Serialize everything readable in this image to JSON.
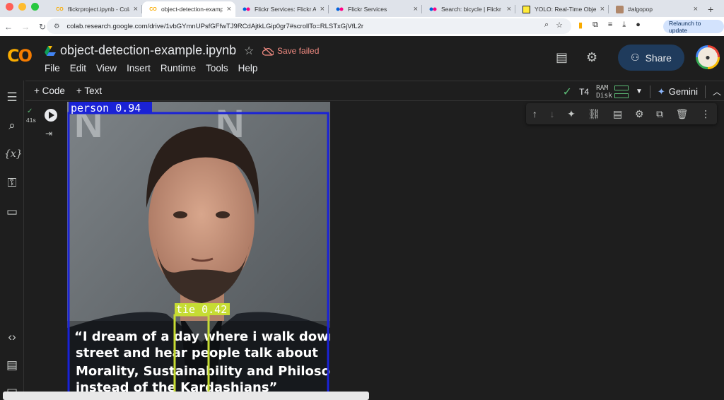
{
  "browser": {
    "tabs": [
      {
        "title": "flickrproject.ipynb - Cola",
        "favicon": "colab"
      },
      {
        "title": "object-detection-examp",
        "favicon": "colab"
      },
      {
        "title": "Flickr Services: Flickr AP",
        "favicon": "flickr"
      },
      {
        "title": "Flickr Services",
        "favicon": "flickr"
      },
      {
        "title": "Search: bicycle | Flickr",
        "favicon": "flickr"
      },
      {
        "title": "YOLO: Real-Time Object",
        "favicon": "yolo"
      },
      {
        "title": "#algopop",
        "favicon": "generic"
      }
    ],
    "url": "colab.research.google.com/drive/1vbGYmnUPsfGFfwTJ9RCdAjtkLGip0gr7#scrollTo=RLSTxGjVfL2r",
    "relaunch_label": "Relaunch to update"
  },
  "colab": {
    "notebook_title": "object-detection-example.ipynb",
    "save_status": "Save failed",
    "menu": [
      "File",
      "Edit",
      "View",
      "Insert",
      "Runtime",
      "Tools",
      "Help"
    ],
    "share_label": "Share",
    "toolbar": {
      "add_code": "+ Code",
      "add_text": "+ Text",
      "runtime_type": "T4",
      "ram_label": "RAM",
      "disk_label": "Disk",
      "gemini_label": "Gemini"
    }
  },
  "cell": {
    "duration": "41s",
    "detections": [
      {
        "label": "person 0.94",
        "color": "#1a22d6"
      },
      {
        "label": "tie 0.42",
        "color": "#c6dc33"
      }
    ],
    "quote_lines": [
      "“I dream of a day where i walk down the",
      "street and hear people talk about",
      "Morality, Sustainability and Philosophy",
      "instead of the Kardashians”"
    ]
  },
  "colors": {
    "accent_green": "#5bb974",
    "share_bg": "#1f3b5c",
    "save_failed": "#f28b82"
  }
}
